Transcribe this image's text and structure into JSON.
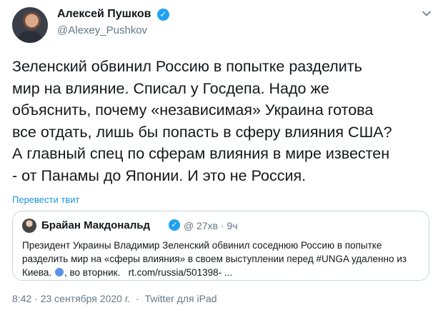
{
  "author": {
    "name": "Алексей Пушков",
    "handle": "@Alexey_Pushkov"
  },
  "tweet": {
    "text": "Зеленский обвинил Россию в попытке разделить\nмир на влияние. Списал у Госдепа. Надо же\nобъяснить, почему «независимая» Украина готова\nвсе отдать, лишь бы попасть в сферу влияния США?\nА главный спец по сферам влияния в мире известен\n- от Панамы до Японии. И это не Россия.",
    "translate_label": "Перевести твит"
  },
  "quoted": {
    "name": "Брайан Макдональд",
    "meta": "@ 27хв · 9ч",
    "text_part1": "Президент Украины Владимир Зеленский обвинил соседнюю Россию в попытке разделить мир на «сферы влияния» в своем выступлении перед #UNGA удаленно из Киева.",
    "text_part2": ", во вторник.",
    "link_text": "rt.com/russia/501398- ..."
  },
  "footer": {
    "datetime": "8:42 · 23 сентября 2020 г.",
    "separator": "·",
    "source": "Twitter для iPad"
  },
  "colors": {
    "accent": "#1da1f2",
    "link": "#1b95e0",
    "muted": "#657786"
  }
}
